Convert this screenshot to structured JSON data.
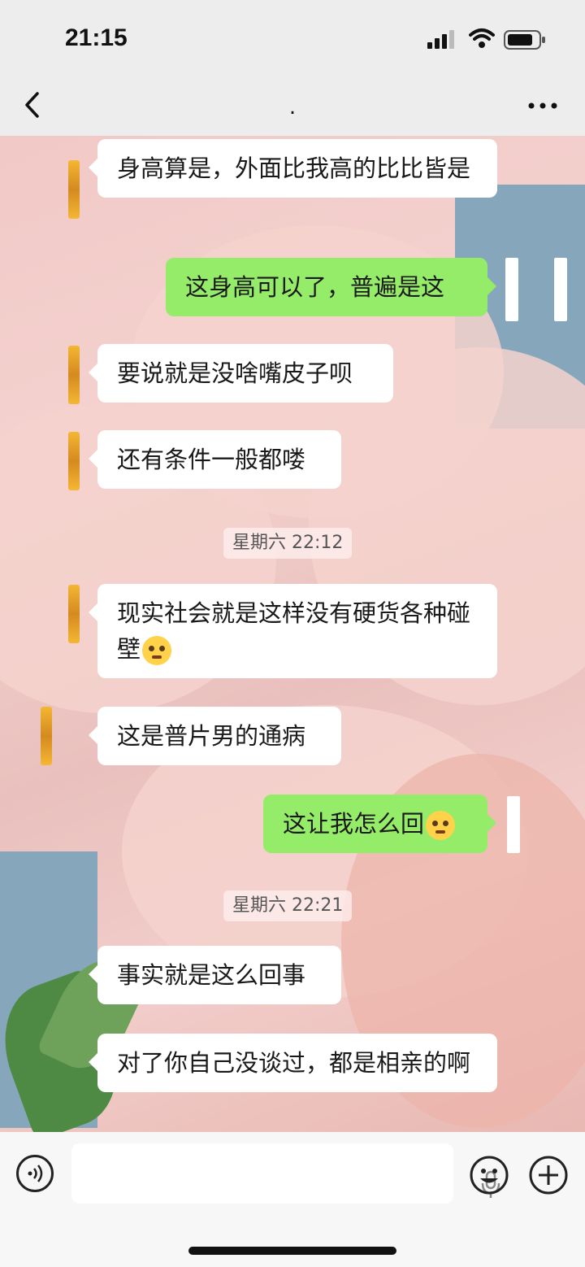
{
  "status": {
    "time": "21:15"
  },
  "nav": {
    "title": "."
  },
  "messages": [
    {
      "side": "left",
      "text": "身高算是，外面比我高的比比皆是"
    },
    {
      "side": "right",
      "text": "这身高可以了，普遍是这"
    },
    {
      "side": "left",
      "text": "要说就是没啥嘴皮子呗"
    },
    {
      "side": "left",
      "text": "还有条件一般都喽"
    },
    {
      "type": "timestamp",
      "text": "星期六 22:12"
    },
    {
      "side": "left",
      "text": "现实社会就是这样没有硬货各种碰壁",
      "emoji": "face-with-tears-emoji"
    },
    {
      "side": "left",
      "text": "这是普片男的通病"
    },
    {
      "side": "right",
      "text": "这让我怎么回",
      "emoji": "pleading-face-emoji"
    },
    {
      "type": "timestamp",
      "text": "星期六 22:21"
    },
    {
      "side": "left",
      "text": "事实就是这么回事"
    },
    {
      "side": "left",
      "text": "对了你自己没谈过，都是相亲的啊"
    }
  ],
  "icons": {
    "back": "chevron-left-icon",
    "more": "more-dots-icon",
    "voice": "voice-icon",
    "mic": "microphone-icon",
    "emoji": "smiley-icon",
    "plus": "plus-icon"
  },
  "colors": {
    "self_bubble": "#95ec69",
    "other_bubble": "#ffffff",
    "bar_bg": "#ededed"
  }
}
